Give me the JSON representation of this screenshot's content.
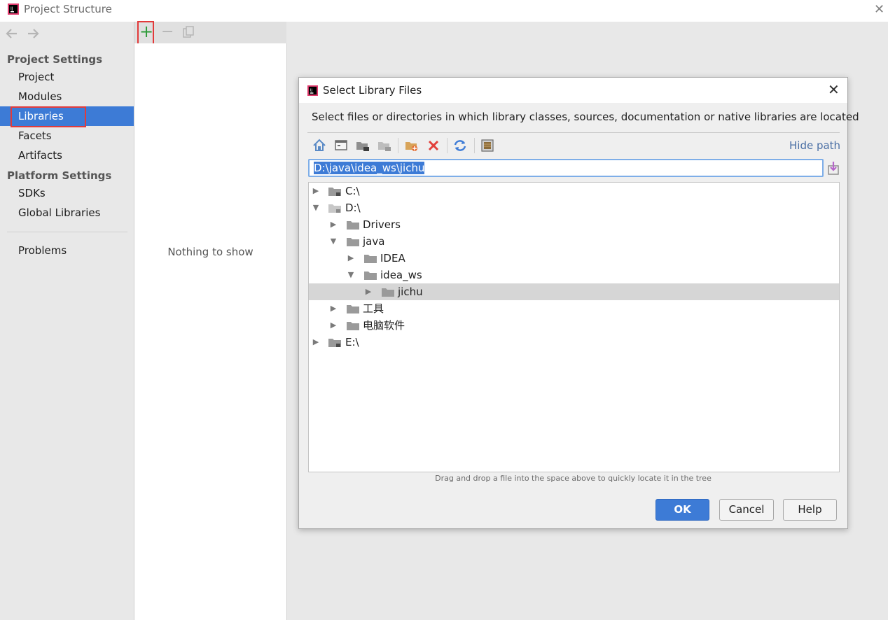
{
  "window": {
    "title": "Project Structure",
    "close_glyph": "✕"
  },
  "sidebar": {
    "back_icon": "arrow-left-icon",
    "forward_icon": "arrow-right-icon",
    "project_settings_title": "Project Settings",
    "platform_settings_title": "Platform Settings",
    "items": [
      {
        "label": "Project"
      },
      {
        "label": "Modules"
      },
      {
        "label": "Libraries",
        "selected": true
      },
      {
        "label": "Facets"
      },
      {
        "label": "Artifacts"
      },
      {
        "label": "SDKs"
      },
      {
        "label": "Global Libraries"
      },
      {
        "label": "Problems"
      }
    ]
  },
  "middle": {
    "add_glyph": "+",
    "remove_glyph": "−",
    "empty_text": "Nothing to show"
  },
  "dialog": {
    "title": "Select Library Files",
    "close_glyph": "✕",
    "description": "Select files or directories in which library classes, sources, documentation or native libraries are located",
    "toolbar_icons": [
      "home-icon",
      "desktop-icon",
      "project-folder-icon",
      "module-folder-icon",
      "new-folder-icon",
      "delete-icon",
      "refresh-icon",
      "show-hidden-icon"
    ],
    "hide_path_label": "Hide path",
    "path_value": "D:\\java\\idea_ws\\jichu",
    "tree": [
      {
        "label": "C:\\",
        "level": 0,
        "expanded": false,
        "drive": true
      },
      {
        "label": "D:\\",
        "level": 0,
        "expanded": true,
        "drive": true
      },
      {
        "label": "Drivers",
        "level": 1,
        "expanded": false
      },
      {
        "label": "java",
        "level": 1,
        "expanded": true
      },
      {
        "label": "IDEA",
        "level": 2,
        "expanded": false
      },
      {
        "label": "idea_ws",
        "level": 2,
        "expanded": true
      },
      {
        "label": "jichu",
        "level": 3,
        "expanded": false,
        "selected": true
      },
      {
        "label": "工具",
        "level": 1,
        "expanded": false
      },
      {
        "label": "电脑软件",
        "level": 1,
        "expanded": false
      },
      {
        "label": "E:\\",
        "level": 0,
        "expanded": false,
        "drive": true
      }
    ],
    "drag_hint": "Drag and drop a file into the space above to quickly locate it in the tree",
    "ok_label": "OK",
    "cancel_label": "Cancel",
    "help_label": "Help"
  },
  "colors": {
    "accent": "#3d7bd6",
    "highlight_box": "#e23b3b"
  }
}
